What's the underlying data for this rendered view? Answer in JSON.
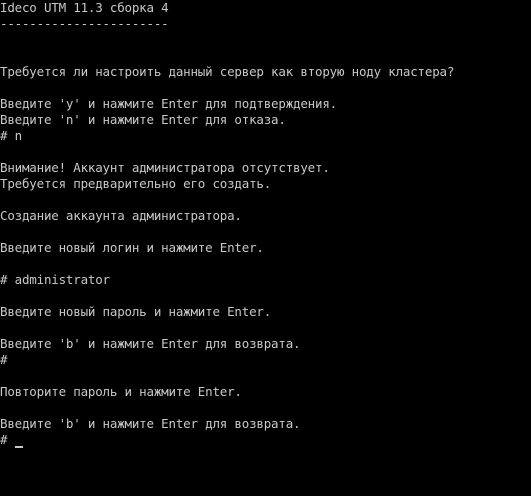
{
  "terminal": {
    "title": "Ideco UTM 11.3 сборка 4",
    "title_underline": "-----------------------",
    "lines": {
      "cluster_question": "Требуется ли настроить данный сервер как вторую ноду кластера?",
      "confirm_hint": "Введите 'y' и нажмите Enter для подтверждения.",
      "cancel_hint": "Введите 'n' и нажмите Enter для отказа.",
      "answer_n": "# n",
      "warning_no_admin": "Внимание! Аккаунт администратора отсутствует.",
      "need_create": "Требуется предварительно его создать.",
      "creating_admin": "Создание аккаунта администратора.",
      "enter_login": "Введите новый логин и нажмите Enter.",
      "login_entry": "# administrator",
      "enter_password": "Введите новый пароль и нажмите Enter.",
      "back_hint_1": "Введите 'b' и нажмите Enter для возврата.",
      "password_entry": "#",
      "repeat_password": "Повторите пароль и нажмите Enter.",
      "back_hint_2": "Введите 'b' и нажмите Enter для возврата.",
      "current_prompt": "#"
    },
    "colors": {
      "background": "#000000",
      "foreground": "#c8c8c8"
    }
  }
}
